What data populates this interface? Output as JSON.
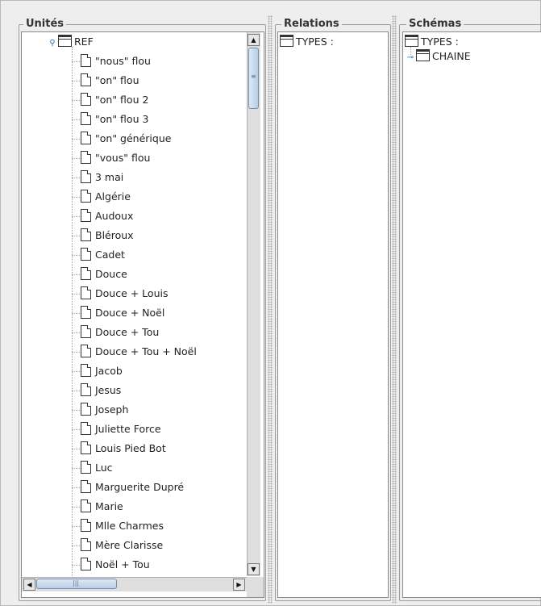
{
  "panels": {
    "units": {
      "title": "Unités"
    },
    "relations": {
      "title": "Relations"
    },
    "schemas": {
      "title": "Schémas"
    }
  },
  "units_tree": {
    "root": "REF",
    "items": [
      "\"nous\" flou",
      "\"on\" flou",
      "\"on\" flou 2",
      "\"on\" flou 3",
      "\"on\" générique",
      "\"vous\" flou",
      "3 mai",
      "Algérie",
      "Audoux",
      "Bléroux",
      "Cadet",
      "Douce",
      "Douce + Louis",
      "Douce + Noël",
      "Douce + Tou",
      "Douce + Tou + Noël",
      "Jacob",
      "Jesus",
      "Joseph",
      "Juliette Force",
      "Louis Pied Bot",
      "Luc",
      "Marguerite Dupré",
      "Marie",
      "Mlle Charmes",
      "Mère Clarisse",
      "Noël + Tou"
    ]
  },
  "relations_tree": {
    "root": "TYPES :"
  },
  "schemas_tree": {
    "root": "TYPES :",
    "children": [
      "CHAINE"
    ]
  },
  "icons": {
    "expanded": "expanded-handle-icon",
    "collapsed": "collapsed-handle-icon",
    "folder": "folder-icon",
    "document": "document-icon"
  }
}
